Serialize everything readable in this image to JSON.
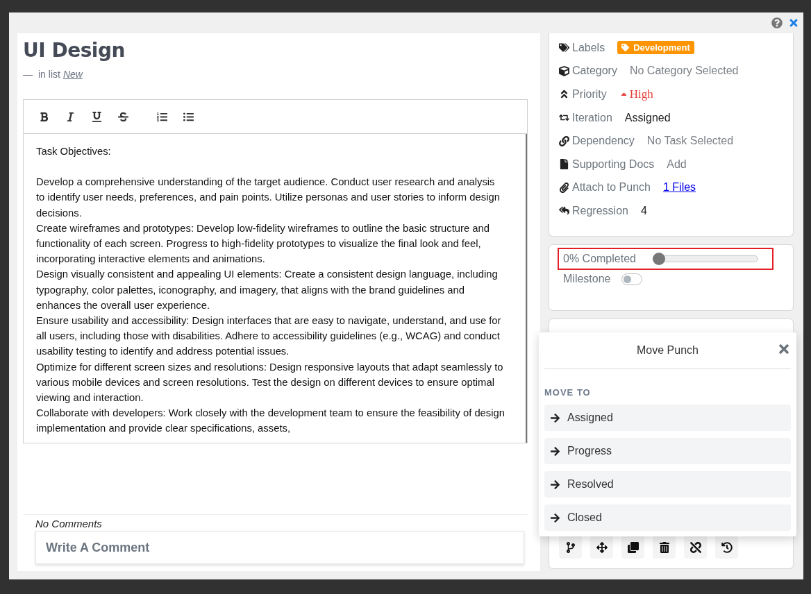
{
  "task": {
    "title": "UI Design",
    "list_prefix": "—",
    "list_label": "in list",
    "list_name": "New"
  },
  "editor": {
    "tools": [
      {
        "kind": "bold"
      },
      {
        "kind": "italic"
      },
      {
        "kind": "underline"
      },
      {
        "kind": "strike"
      },
      {
        "kind": "ordered-list"
      },
      {
        "kind": "bullet-list"
      }
    ],
    "paragraphs": [
      "Task Objectives:",
      "Develop a comprehensive understanding of the target audience. Conduct user research and analysis to identify user needs, preferences, and pain points. Utilize personas and user stories to inform design decisions.",
      "Create wireframes and prototypes: Develop low-fidelity wireframes to outline the basic structure and functionality of each screen. Progress to high-fidelity prototypes to visualize the final look and feel, incorporating interactive elements and animations.",
      "Design visually consistent and appealing UI elements: Create a consistent design language, including typography, color palettes, iconography, and imagery, that aligns with the brand guidelines and enhances the overall user experience.",
      "Ensure usability and accessibility: Design interfaces that are easy to navigate, understand, and use for all users, including those with disabilities. Adhere to accessibility guidelines (e.g., WCAG) and conduct usability testing to identify and address potential issues.",
      "Optimize for different screen sizes and resolutions: Design responsive layouts that adapt seamlessly to various mobile devices and screen resolutions. Test the design on different devices to ensure optimal viewing and interaction.",
      "Collaborate with developers: Work closely with the development team to ensure the feasibility of design implementation and provide clear specifications, assets,"
    ]
  },
  "comments": {
    "empty_text": "No Comments",
    "placeholder": "Write A Comment"
  },
  "details": [
    {
      "kind": "labels",
      "label": "Labels",
      "value": "Development",
      "color": "#fd9400"
    },
    {
      "kind": "category",
      "label": "Category",
      "value": "No Category Selected"
    },
    {
      "kind": "priority",
      "label": "Priority",
      "value": "High",
      "color": "#e8403a"
    },
    {
      "kind": "iteration",
      "label": "Iteration",
      "value": "Assigned"
    },
    {
      "kind": "dependency",
      "label": "Dependency",
      "value": "No Task Selected"
    },
    {
      "kind": "docs",
      "label": "Supporting Docs",
      "value": "Add"
    },
    {
      "kind": "attachment",
      "label": "Attach to Punch",
      "value": "1 Files"
    },
    {
      "kind": "regression",
      "label": "Regression",
      "value": "4"
    }
  ],
  "progress": {
    "label": "0% Completed",
    "level": 0,
    "highlighted": true
  },
  "milestone": {
    "label": "Milestone",
    "on": false
  },
  "actions": [
    {
      "kind": "branch"
    },
    {
      "kind": "move"
    },
    {
      "kind": "copy"
    },
    {
      "kind": "delete"
    },
    {
      "kind": "unlink"
    },
    {
      "kind": "history"
    }
  ],
  "move_popover": {
    "title": "Move Punch",
    "section": "MOVE TO",
    "options": [
      "Assigned",
      "Progress",
      "Resolved",
      "Closed"
    ]
  }
}
